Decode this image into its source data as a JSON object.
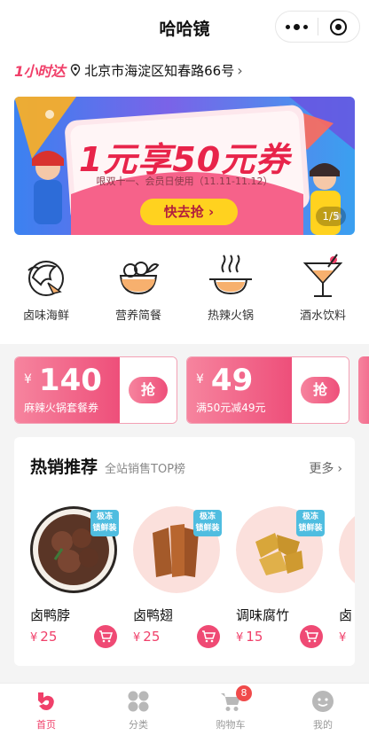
{
  "nav": {
    "title": "哈哈镜"
  },
  "location": {
    "brand": "1小时达",
    "address": "北京市海淀区知春路66号"
  },
  "banner": {
    "title": "1元享50元券",
    "subtitle": "哏双十一、会员日使用（11.11-11.12）",
    "button": "快去抢",
    "indicator": "1/5"
  },
  "categories": [
    {
      "label": "卤味海鲜",
      "icon": "shrimp-icon"
    },
    {
      "label": "营养简餐",
      "icon": "bowl-icon"
    },
    {
      "label": "热辣火锅",
      "icon": "hotpot-icon"
    },
    {
      "label": "酒水饮料",
      "icon": "cocktail-icon"
    }
  ],
  "coupons": [
    {
      "currency": "¥",
      "amount": "140",
      "desc": "麻辣火锅套餐券",
      "button": "抢"
    },
    {
      "currency": "¥",
      "amount": "49",
      "desc": "满50元减49元",
      "button": "抢"
    }
  ],
  "hot": {
    "title": "热销推荐",
    "subtitle": "全站销售TOP榜",
    "more": "更多",
    "products": [
      {
        "name": "卤鸭脖",
        "currency": "¥",
        "price": "25",
        "badge": [
          "极冻",
          "锁鲜装"
        ]
      },
      {
        "name": "卤鸭翅",
        "currency": "¥",
        "price": "25",
        "badge": [
          "极冻",
          "锁鲜装"
        ]
      },
      {
        "name": "调味腐竹",
        "currency": "¥",
        "price": "15",
        "badge": [
          "极冻",
          "锁鲜装"
        ]
      },
      {
        "name": "卤",
        "currency": "¥",
        "price": ""
      }
    ]
  },
  "tabbar": {
    "items": [
      {
        "label": "首页",
        "icon": "home-icon",
        "active": true
      },
      {
        "label": "分类",
        "icon": "category-icon"
      },
      {
        "label": "购物车",
        "icon": "cart-icon",
        "badge": "8"
      },
      {
        "label": "我的",
        "icon": "profile-icon"
      }
    ]
  },
  "colors": {
    "accent": "#f0406a",
    "banner_button": "#ffd21f",
    "badge_blue": "#4fbde0"
  }
}
